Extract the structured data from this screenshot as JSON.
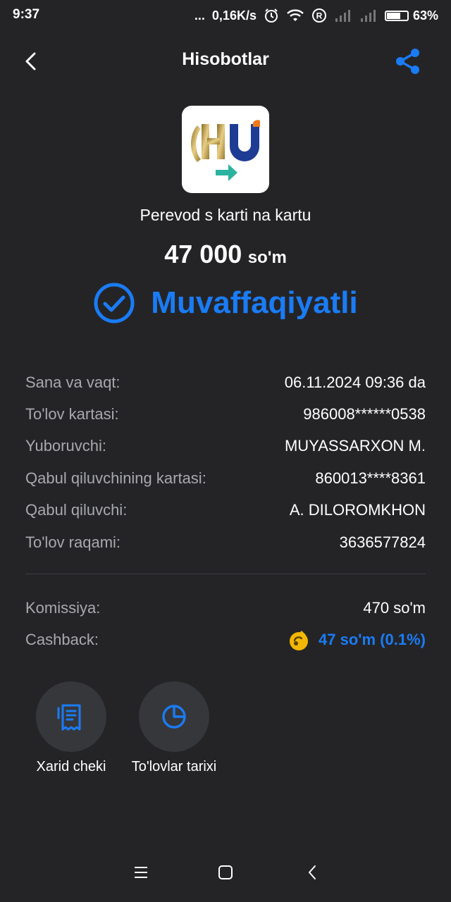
{
  "status_bar": {
    "time": "9:37",
    "dots": "...",
    "speed": "0,16K/s",
    "battery": "63%",
    "battery_level": 0.63
  },
  "header": {
    "title": "Hisobotlar"
  },
  "transaction": {
    "operation": "Perevod s karti na kartu",
    "amount": "47 000",
    "currency": "so'm",
    "status": "Muvaffaqiyatli"
  },
  "details": [
    {
      "label": "Sana va vaqt:",
      "value": "06.11.2024 09:36 da"
    },
    {
      "label": "To'lov kartasi:",
      "value": "986008******0538"
    },
    {
      "label": "Yuboruvchi:",
      "value": "MUYASSARXON M."
    },
    {
      "label": "Qabul qiluvchining kartasi:",
      "value": "860013****8361"
    },
    {
      "label": "Qabul qiluvchi:",
      "value": "A. DILOROMKHON"
    },
    {
      "label": "To'lov raqami:",
      "value": "3636577824"
    }
  ],
  "fees": {
    "commission_label": "Komissiya:",
    "commission_value": "470 so'm",
    "cashback_label": "Cashback:",
    "cashback_value": "47 so'm (0.1%)"
  },
  "actions": [
    {
      "label": "Xarid cheki",
      "icon": "receipt-icon"
    },
    {
      "label": "To'lovlar tarixi",
      "icon": "pie-chart-icon"
    }
  ],
  "colors": {
    "background": "#242427",
    "accent": "#1a7cf5",
    "label": "#a8a9ad",
    "button_bg": "#36373b",
    "cashback_coin": "#f2b705"
  }
}
